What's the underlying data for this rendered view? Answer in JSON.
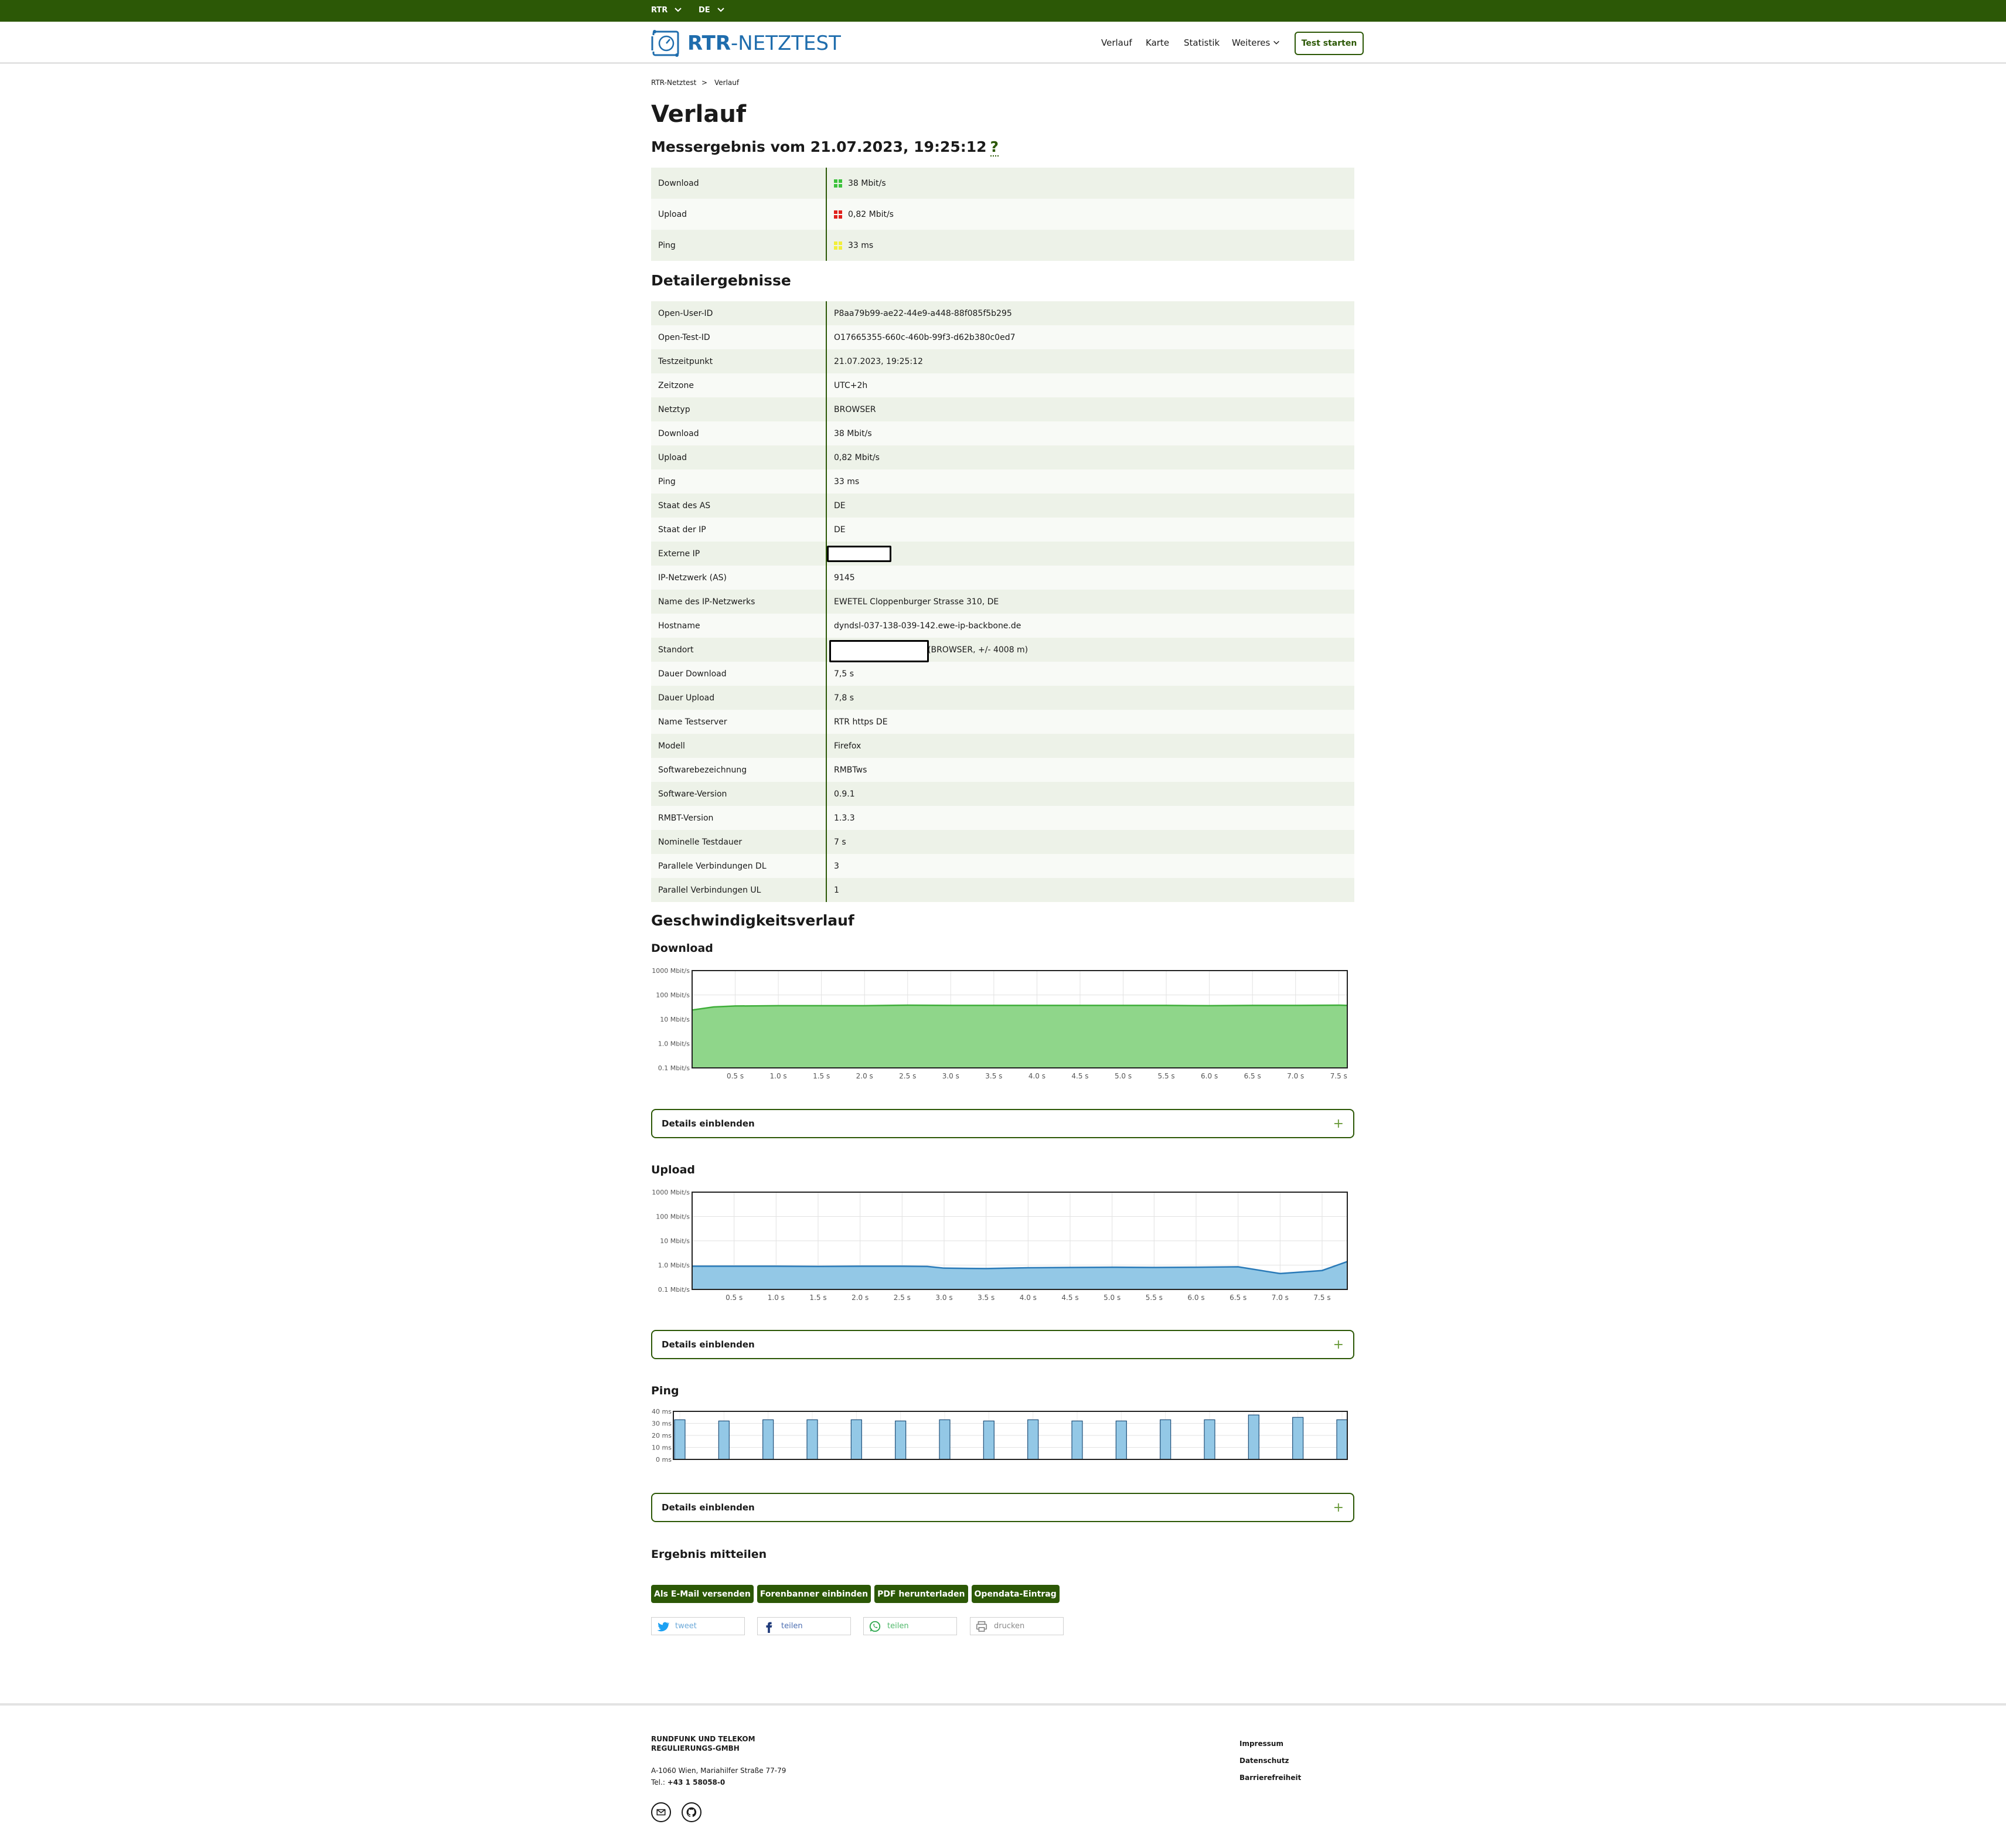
{
  "topbar": {
    "rtr": "RTR",
    "lang": "DE"
  },
  "header": {
    "logo_prefix": "RTR",
    "logo_suffix": "-NETZTEST",
    "nav": [
      "Verlauf",
      "Karte",
      "Statistik",
      "Weiteres"
    ],
    "start_button": "Test starten"
  },
  "breadcrumb": {
    "home": "RTR-Netztest",
    "sep": ">",
    "current": "Verlauf"
  },
  "page_title": "Verlauf",
  "result": {
    "heading": "Messergebnis vom 21.07.2023, 19:25:12",
    "help": "?",
    "rows": [
      {
        "label": "Download",
        "value": "38 Mbit/s",
        "color": "#3cc23c"
      },
      {
        "label": "Upload",
        "value": "0,82 Mbit/s",
        "color": "#e0201c"
      },
      {
        "label": "Ping",
        "value": "33 ms",
        "color": "#f2ef3a"
      }
    ]
  },
  "details": {
    "heading": "Detailergebnisse",
    "rows": [
      {
        "label": "Open-User-ID",
        "value": "P8aa79b99-ae22-44e9-a448-88f085f5b295"
      },
      {
        "label": "Open-Test-ID",
        "value": "O17665355-660c-460b-99f3-d62b380c0ed7"
      },
      {
        "label": "Testzeitpunkt",
        "value": "21.07.2023, 19:25:12"
      },
      {
        "label": "Zeitzone",
        "value": "UTC+2h"
      },
      {
        "label": "Netztyp",
        "value": "BROWSER"
      },
      {
        "label": "Download",
        "value": "38 Mbit/s"
      },
      {
        "label": "Upload",
        "value": "0,82 Mbit/s"
      },
      {
        "label": "Ping",
        "value": "33 ms"
      },
      {
        "label": "Staat des AS",
        "value": "DE"
      },
      {
        "label": "Staat der IP",
        "value": "DE"
      },
      {
        "label": "Externe IP",
        "value": ""
      },
      {
        "label": "IP-Netzwerk (AS)",
        "value": "9145"
      },
      {
        "label": "Name des IP-Netzwerks",
        "value": "EWETEL Cloppenburger Strasse 310, DE"
      },
      {
        "label": "Hostname",
        "value": "dyndsl-037-138-039-142.ewe-ip-backbone.de"
      },
      {
        "label": "Standort",
        "value": "(BROWSER, +/- 4008 m)"
      },
      {
        "label": "Dauer Download",
        "value": "7,5 s"
      },
      {
        "label": "Dauer Upload",
        "value": "7,8 s"
      },
      {
        "label": "Name Testserver",
        "value": "RTR https DE"
      },
      {
        "label": "Modell",
        "value": "Firefox"
      },
      {
        "label": "Softwarebezeichnung",
        "value": "RMBTws"
      },
      {
        "label": "Software-Version",
        "value": "0.9.1"
      },
      {
        "label": "RMBT-Version",
        "value": "1.3.3"
      },
      {
        "label": "Nominelle Testdauer",
        "value": "7 s"
      },
      {
        "label": "Parallele Verbindungen DL",
        "value": "3"
      },
      {
        "label": "Parallel Verbindungen UL",
        "value": "1"
      }
    ]
  },
  "speed_heading": "Geschwindigkeitsverlauf",
  "details_toggle": "Details einblenden",
  "plus": "+",
  "chart_data": [
    {
      "type": "area",
      "title": "Download",
      "yticks": [
        "1000 Mbit/s",
        "100 Mbit/s",
        "10 Mbit/s",
        "1.0 Mbit/s",
        "0.1 Mbit/s"
      ],
      "yscale": "log",
      "ylim": [
        0.1,
        1000
      ],
      "xticks": [
        "0.5 s",
        "1.0 s",
        "1.5 s",
        "2.0 s",
        "2.5 s",
        "3.0 s",
        "3.5 s",
        "4.0 s",
        "4.5 s",
        "5.0 s",
        "5.5 s",
        "6.0 s",
        "6.5 s",
        "7.0 s",
        "7.5 s"
      ],
      "xlim": [
        0,
        7.6
      ],
      "grid": true,
      "color": "#8fd68a",
      "x": [
        0,
        0.25,
        0.5,
        1,
        1.5,
        2,
        2.5,
        3,
        3.5,
        4,
        4.5,
        5,
        5.5,
        6,
        6.5,
        7,
        7.5,
        7.6
      ],
      "values": [
        24,
        32,
        35,
        36,
        36,
        36,
        38,
        37,
        37,
        37,
        37,
        37,
        37,
        36,
        37,
        37,
        38,
        37
      ]
    },
    {
      "type": "area",
      "title": "Upload",
      "yticks": [
        "1000 Mbit/s",
        "100 Mbit/s",
        "10 Mbit/s",
        "1.0 Mbit/s",
        "0.1 Mbit/s"
      ],
      "yscale": "log",
      "ylim": [
        0.1,
        1000
      ],
      "xticks": [
        "0.5 s",
        "1.0 s",
        "1.5 s",
        "2.0 s",
        "2.5 s",
        "3.0 s",
        "3.5 s",
        "4.0 s",
        "4.5 s",
        "5.0 s",
        "5.5 s",
        "6.0 s",
        "6.5 s",
        "7.0 s",
        "7.5 s"
      ],
      "xlim": [
        0,
        7.8
      ],
      "grid": true,
      "color": "#93c8e6",
      "x": [
        0,
        0.5,
        1,
        1.5,
        2,
        2.5,
        2.8,
        3,
        3.5,
        4,
        4.5,
        5,
        5.5,
        6,
        6.5,
        7,
        7.5,
        7.8
      ],
      "values": [
        0.9,
        0.9,
        0.9,
        0.88,
        0.9,
        0.9,
        0.88,
        0.75,
        0.72,
        0.78,
        0.8,
        0.82,
        0.8,
        0.82,
        0.85,
        0.45,
        0.6,
        1.4
      ]
    },
    {
      "type": "bar",
      "title": "Ping",
      "yticks": [
        "40 ms",
        "30 ms",
        "20 ms",
        "10 ms",
        "0 ms"
      ],
      "ylim": [
        0,
        40
      ],
      "grid": true,
      "color": "#93c8e6",
      "values": [
        33,
        32,
        33,
        33,
        33,
        32,
        33,
        32,
        33,
        32,
        32,
        33,
        33,
        37,
        35,
        33
      ]
    }
  ],
  "share": {
    "heading": "Ergebnis mitteilen",
    "buttons": [
      "Als E-Mail versenden",
      "Forenbanner einbinden",
      "PDF herunterladen",
      "Opendata-Eintrag"
    ],
    "social": [
      "tweet",
      "teilen",
      "teilen",
      "drucken"
    ]
  },
  "footer": {
    "org_line1": "RUNDFUNK UND TELEKOM",
    "org_line2": "REGULIERUNGS-GMBH",
    "address": "A-1060 Wien, Mariahilfer Straße 77-79",
    "tel_label": "Tel.: ",
    "tel": "+43 1 58058-0",
    "links": [
      "Impressum",
      "Datenschutz",
      "Barrierefreiheit"
    ]
  }
}
